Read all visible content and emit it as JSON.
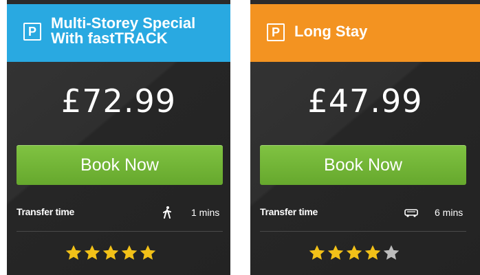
{
  "cards": [
    {
      "title_lines": [
        "Multi-Storey Special",
        "With fastTRACK"
      ],
      "badge": "P",
      "header_color": "#29a9e1",
      "price": "£72.99",
      "button_label": "Book Now",
      "transfer_label": "Transfer time",
      "transfer_icon": "walking-person-icon",
      "transfer_value": "1 mins",
      "rating": 5,
      "rating_max": 5
    },
    {
      "title_lines": [
        "Long Stay"
      ],
      "badge": "P",
      "header_color": "#f39321",
      "price": "£47.99",
      "button_label": "Book Now",
      "transfer_label": "Transfer time",
      "transfer_icon": "bus-icon",
      "transfer_value": "6 mins",
      "rating": 4,
      "rating_max": 5
    }
  ],
  "colors": {
    "button_green": "#73b538",
    "star_gold": "#f2c118",
    "star_grey": "#bcbcbc",
    "card_dark": "#2b2b2b"
  }
}
